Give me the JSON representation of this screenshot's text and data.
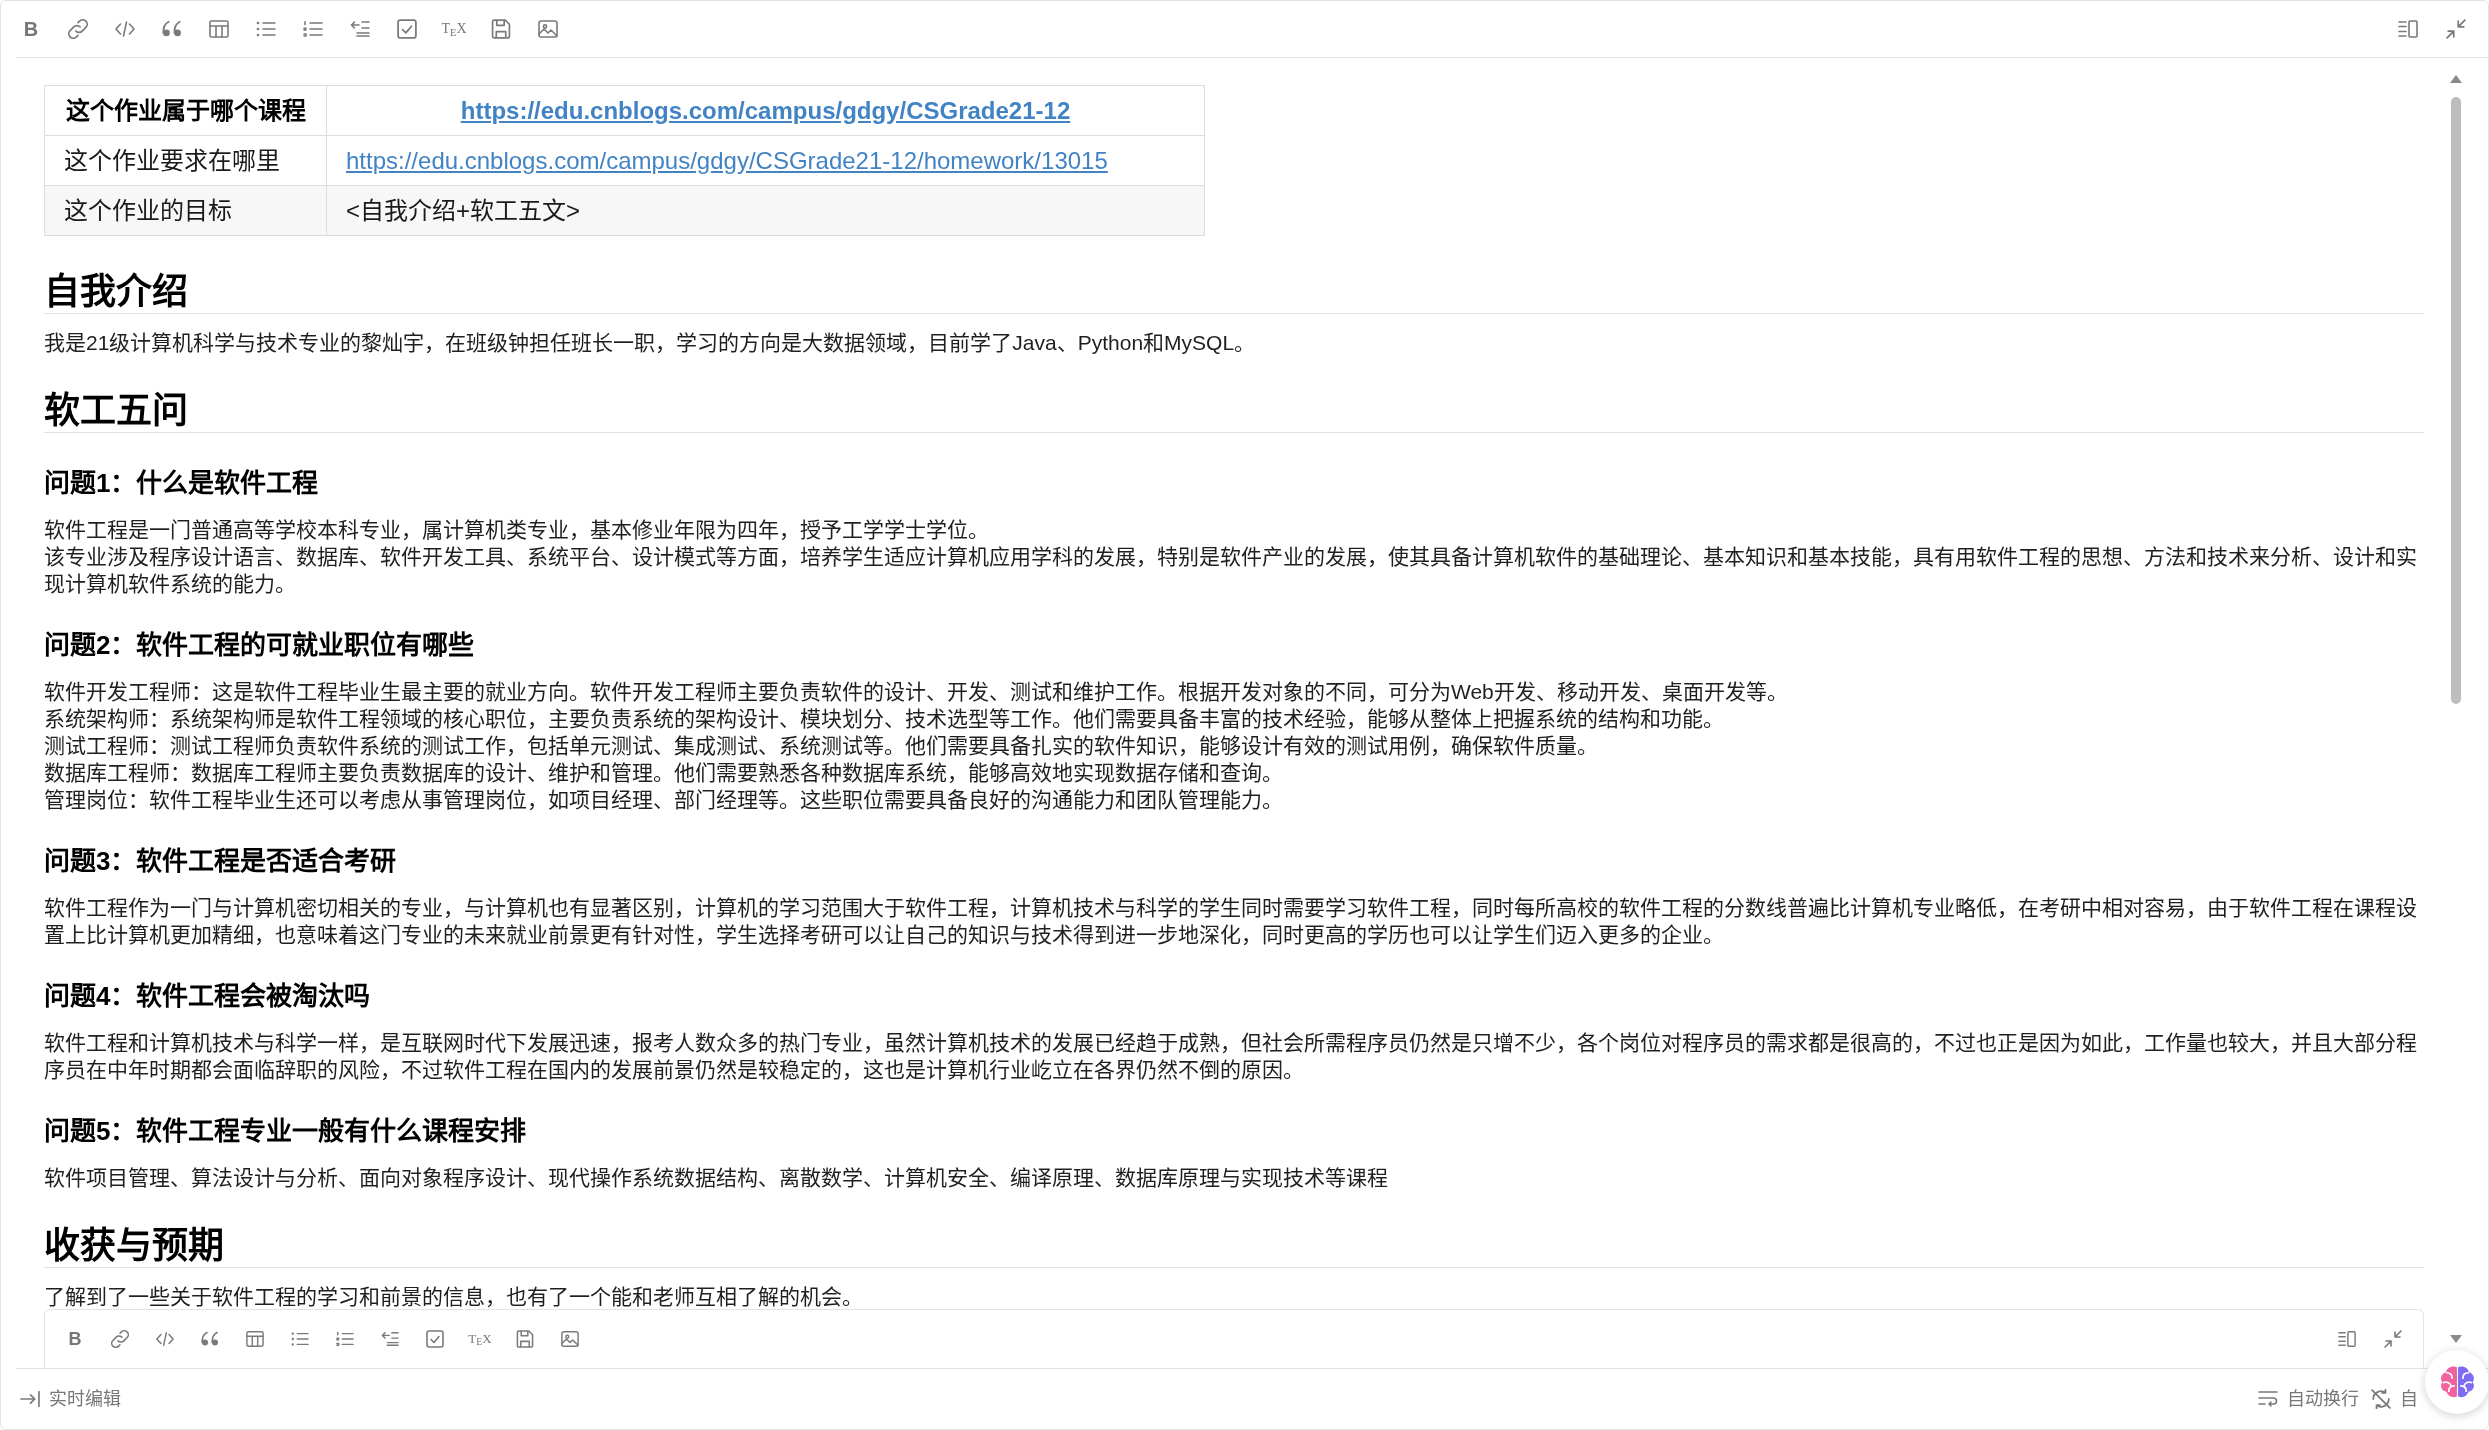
{
  "toolbar": {
    "tools": [
      {
        "kind": "bold",
        "glyph": "B"
      },
      {
        "kind": "link"
      },
      {
        "kind": "code"
      },
      {
        "kind": "quote"
      },
      {
        "kind": "table"
      },
      {
        "kind": "bullet-list"
      },
      {
        "kind": "numbered-list"
      },
      {
        "kind": "outdent"
      },
      {
        "kind": "task"
      },
      {
        "kind": "tex",
        "glyph": "T$_{E}$X"
      },
      {
        "kind": "save"
      },
      {
        "kind": "image"
      }
    ],
    "view_tools": [
      {
        "kind": "split-view"
      },
      {
        "kind": "collapse"
      }
    ]
  },
  "table": {
    "columns": [
      {
        "kind": "text",
        "text": "这个作业属于哪个课程"
      },
      {
        "kind": "link",
        "text": "https://edu.cnblogs.com/campus/gdgy/CSGrade21-12"
      }
    ],
    "rows": [
      [
        {
          "kind": "text",
          "text": "这个作业要求在哪里"
        },
        {
          "kind": "link",
          "text": "https://edu.cnblogs.com/campus/gdgy/CSGrade21-12/homework/13015"
        }
      ],
      [
        {
          "kind": "text",
          "text": "这个作业的目标"
        },
        {
          "kind": "text",
          "text": "<自我介绍+软工五文>"
        }
      ]
    ]
  },
  "document": [
    {
      "kind": "heading",
      "text": "自我介绍"
    },
    {
      "kind": "paragraph",
      "lines": [
        "我是21级计算机科学与技术专业的黎灿宇，在班级钟担任班长一职，学习的方向是大数据领域，目前学了Java、Python和MySQL。"
      ]
    },
    {
      "kind": "heading",
      "text": "软工五问"
    },
    {
      "kind": "subheading",
      "text": "问题1：什么是软件工程"
    },
    {
      "kind": "paragraph",
      "lines": [
        "软件工程是一门普通高等学校本科专业，属计算机类专业，基本修业年限为四年，授予工学学士学位。",
        "该专业涉及程序设计语言、数据库、软件开发工具、系统平台、设计模式等方面，培养学生适应计算机应用学科的发展，特别是软件产业的发展，使其具备计算机软件的基础理论、基本知识和基本技能，具有用软件工程的思想、方法和技术来分析、设计和实现计算机软件系统的能力。"
      ]
    },
    {
      "kind": "subheading",
      "text": "问题2：软件工程的可就业职位有哪些"
    },
    {
      "kind": "paragraph",
      "lines": [
        "软件开发工程师：这是软件工程毕业生最主要的就业方向。软件开发工程师主要负责软件的设计、开发、测试和维护工作。根据开发对象的不同，可分为Web开发、移动开发、桌面开发等。",
        "系统架构师：系统架构师是软件工程领域的核心职位，主要负责系统的架构设计、模块划分、技术选型等工作。他们需要具备丰富的技术经验，能够从整体上把握系统的结构和功能。",
        "测试工程师：测试工程师负责软件系统的测试工作，包括单元测试、集成测试、系统测试等。他们需要具备扎实的软件知识，能够设计有效的测试用例，确保软件质量。",
        "数据库工程师：数据库工程师主要负责数据库的设计、维护和管理。他们需要熟悉各种数据库系统，能够高效地实现数据存储和查询。",
        "管理岗位：软件工程毕业生还可以考虑从事管理岗位，如项目经理、部门经理等。这些职位需要具备良好的沟通能力和团队管理能力。"
      ]
    },
    {
      "kind": "subheading",
      "text": "问题3：软件工程是否适合考研"
    },
    {
      "kind": "paragraph",
      "lines": [
        "软件工程作为一门与计算机密切相关的专业，与计算机也有显著区别，计算机的学习范围大于软件工程，计算机技术与科学的学生同时需要学习软件工程，同时每所高校的软件工程的分数线普遍比计算机专业略低，在考研中相对容易，由于软件工程在课程设置上比计算机更加精细，也意味着这门专业的未来就业前景更有针对性，学生选择考研可以让自己的知识与技术得到进一步地深化，同时更高的学历也可以让学生们迈入更多的企业。"
      ]
    },
    {
      "kind": "subheading",
      "text": "问题4：软件工程会被淘汰吗"
    },
    {
      "kind": "paragraph",
      "lines": [
        "软件工程和计算机技术与科学一样，是互联网时代下发展迅速，报考人数众多的热门专业，虽然计算机技术的发展已经趋于成熟，但社会所需程序员仍然是只增不少，各个岗位对程序员的需求都是很高的，不过也正是因为如此，工作量也较大，并且大部分程序员在中年时期都会面临辞职的风险，不过软件工程在国内的发展前景仍然是较稳定的，这也是计算机行业屹立在各界仍然不倒的原因。"
      ]
    },
    {
      "kind": "subheading",
      "text": "问题5：软件工程专业一般有什么课程安排"
    },
    {
      "kind": "paragraph",
      "lines": [
        "软件项目管理、算法设计与分析、面向对象程序设计、现代操作系统数据结构、离散数学、计算机安全、编译原理、数据库原理与实现技术等课程"
      ]
    },
    {
      "kind": "heading",
      "text": "收获与预期"
    },
    {
      "kind": "paragraph",
      "lines": [
        "了解到了一些关于软件工程的学习和前景的信息，也有了一个能和老师互相了解的机会。"
      ]
    }
  ],
  "floating_toolbar": {
    "tools": [
      {
        "kind": "bold",
        "glyph": "B"
      },
      {
        "kind": "link"
      },
      {
        "kind": "code"
      },
      {
        "kind": "quote"
      },
      {
        "kind": "table"
      },
      {
        "kind": "bullet-list"
      },
      {
        "kind": "numbered-list"
      },
      {
        "kind": "outdent"
      },
      {
        "kind": "task"
      },
      {
        "kind": "tex",
        "glyph": "T$_{E}$X"
      },
      {
        "kind": "save"
      },
      {
        "kind": "image"
      }
    ],
    "view_tools": [
      {
        "kind": "split-view"
      },
      {
        "kind": "collapse"
      }
    ]
  },
  "status_bar": {
    "left": [
      {
        "kind": "live-edit",
        "label": "实时编辑"
      }
    ],
    "right": [
      {
        "kind": "wrap",
        "label": "自动换行"
      },
      {
        "kind": "sync",
        "label": "自"
      }
    ]
  }
}
